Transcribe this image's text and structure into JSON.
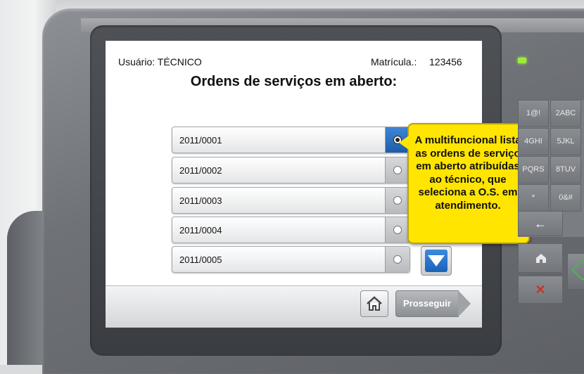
{
  "screen": {
    "user_label": "Usuário: TÉCNICO",
    "registration_label": "Matrícula.:",
    "registration_value": "123456",
    "title": "Ordens de serviços em aberto:",
    "orders": [
      {
        "id": "2011/0001",
        "selected": true
      },
      {
        "id": "2011/0002",
        "selected": false
      },
      {
        "id": "2011/0003",
        "selected": false
      },
      {
        "id": "2011/0004",
        "selected": false
      },
      {
        "id": "2011/0005",
        "selected": false
      }
    ],
    "proceed_label": "Prosseguir"
  },
  "callout": {
    "text": "A multifuncional lista as ordens de serviço em aberto atribuídas ao técnico, que seleciona a O.S. em atendimento."
  },
  "keypad": {
    "keys": [
      {
        "label": "1@!"
      },
      {
        "label": "2ABC"
      },
      {
        "label": "4GHI"
      },
      {
        "label": "5JKL"
      },
      {
        "label": "PQRS"
      },
      {
        "label": "8TUV"
      },
      {
        "label": "*"
      },
      {
        "label": "0&#"
      }
    ],
    "back_symbol": "←",
    "cancel_symbol": "✕"
  },
  "colors": {
    "accent_blue": "#1e5da8",
    "callout_yellow": "#ffe500",
    "led_green": "#9bee36"
  }
}
